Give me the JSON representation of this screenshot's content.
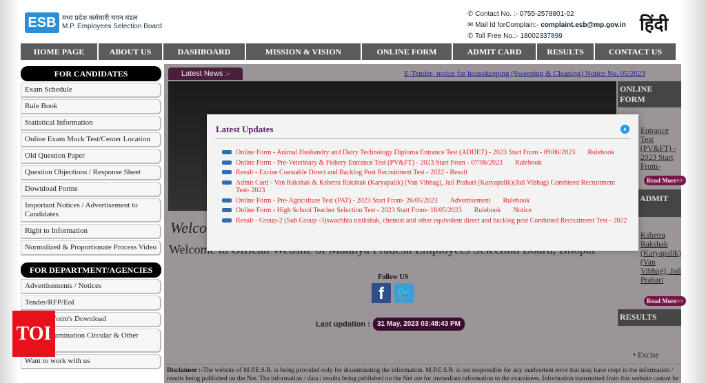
{
  "header": {
    "logo_mark": "ESB",
    "logo_hindi": "मध्य प्रदेश कर्मचारी चयन मंडल",
    "logo_english": "M.P. Employees Selection Board",
    "contact": "Contact No. :- 0755-2578801-02",
    "mail_label": "Mail Id forComplain:-",
    "mail": "complaint.esb@mp.gov.in",
    "tollfree": "Toll Free No.:- 18002337899",
    "hindi_link": "हिंदी"
  },
  "nav": [
    "HOME PAGE",
    "ABOUT US",
    "DASHBOARD",
    "MISSION & VISION",
    "ONLINE FORM",
    "ADMIT CARD",
    "RESULTS",
    "CONTACT US"
  ],
  "sidebar": {
    "candidates_title": "FOR CANDIDATES",
    "candidates": [
      "Exam Schedule",
      "Rule Book",
      "Statistical Information",
      "Online Exam Mock Test/Center Location",
      "Old Question Paper",
      "Question Objections / Response Sheet",
      "Download Forms",
      "Important Notices / Advertisement to Candidates",
      "Right to Information",
      "Normalized & Proportionate Process Video"
    ],
    "dept_title": "FOR DEPARTMENT/AGENCIES",
    "dept": [
      "Advertisements / Notices",
      "Tender/RFP/EoI",
      "Rules & Form's Download",
      "Group Examination Circular & Other Order",
      "Want to work with us"
    ]
  },
  "news": {
    "label": "Latest News :-",
    "ticker": "E-Tender- notice for housekeeping (Sweeping & Cleaning) Notice No. 05/2023"
  },
  "main": {
    "welcome_italic": "Welco",
    "welcome": "Welcome to Official Website of Madhya Pradesh Employees Selection Board, Bhopal",
    "follow": "Follow US",
    "last_label": "Last updation :",
    "last_value": "31 May, 2023 03:48:43 PM",
    "disclaimer_bold": "Disclaimer :-",
    "disclaimer": "The website of M.P.E.S.B. is being provided only for disseminating the information. M.P.E.S.B. is not responsible for any inadvertent error that may have crept in the information / results being published on the Net. The information / data / results being published on the Net are for immediate information to the examinees. Information transmitted from this website cannot be"
  },
  "right": {
    "online_title": "ONLINE FORM",
    "online_text": "Entrance Test (PV&FT) - 2023 Start From-",
    "read_more": "Read More>>",
    "admit_title": "ADMIT",
    "admit_text": "Kshetra Rakshak (Karyapalik) (Van Vibhag), Jail Prahari",
    "results_title": "RESULTS",
    "results_text": "Excise"
  },
  "modal": {
    "title": "Latest Updates",
    "close": "x",
    "items": [
      {
        "text": "Online Form - Animal Husbandry and Dairy Technology Diploma Entrance Test (ADDET) - 2023 Start From - 09/06/2023",
        "links": [
          "Rulebook"
        ]
      },
      {
        "text": "Online Form - Pre-Veterinary & Fishery Entrance Test (PV&FT) - 2023 Start From - 07/06/2023",
        "links": [
          "Rulebook"
        ]
      },
      {
        "text": "Result - Excise Constable Direct and Backlog Post Recruitment Test - 2022 - Result",
        "links": []
      },
      {
        "text": "Admit Card  - Van Rakshak & Kshetra Rakshak (Karyapalik) (Van Vibhag), Jail Prahari (Karyapalik)(Jail Vibhag) Combined Recruitment Test- 2023",
        "links": []
      },
      {
        "text": "Online Form - Pre-Agriculture Test (PAT) - 2023 Start From- 26/05/2023",
        "links": [
          "Advertisement",
          "Rulebook"
        ]
      },
      {
        "text": "Online Form - High School Teacher Selection Test - 2023 Start From- 18/05/2023",
        "links": [
          "Rulebook",
          "Notice"
        ]
      },
      {
        "text": "Result - Group-2 (Sub Group -3)swachhta nirikshak, chemist and other equivalent direct and backlog post Combined Recruitment Test - 2022",
        "links": []
      }
    ]
  },
  "watermark": "TOI",
  "colors": {
    "nav": "#5b5b5b",
    "modal_title": "#5a2265",
    "update_text": "#e0262c",
    "close": "#1e9be8",
    "toi": "#e8101a"
  }
}
